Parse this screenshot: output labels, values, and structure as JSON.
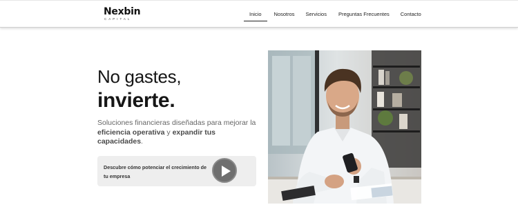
{
  "brand": {
    "name": "Nexbin",
    "tagline": "CAPITAL"
  },
  "nav": {
    "items": [
      {
        "label": "Inicio",
        "active": true
      },
      {
        "label": "Nosotros",
        "active": false
      },
      {
        "label": "Servicios",
        "active": false
      },
      {
        "label": "Preguntas Frecuentes",
        "active": false
      },
      {
        "label": "Contacto",
        "active": false
      }
    ]
  },
  "hero": {
    "title_line1": "No gastes,",
    "title_line2": "invierte.",
    "subtitle_part1": "Soluciones financieras diseñadas para mejorar la ",
    "subtitle_bold1": "eficiencia operativa",
    "subtitle_part2": " y ",
    "subtitle_bold2": "expandir tus capacidades",
    "subtitle_end": ".",
    "cta_text": "Descubre cómo potenciar el crecimiento de tu empresa",
    "play_icon": "play-icon"
  },
  "colors": {
    "nav_active_underline": "#222222",
    "cta_background": "#eeeeee",
    "play_button": "#6f6f6f"
  }
}
